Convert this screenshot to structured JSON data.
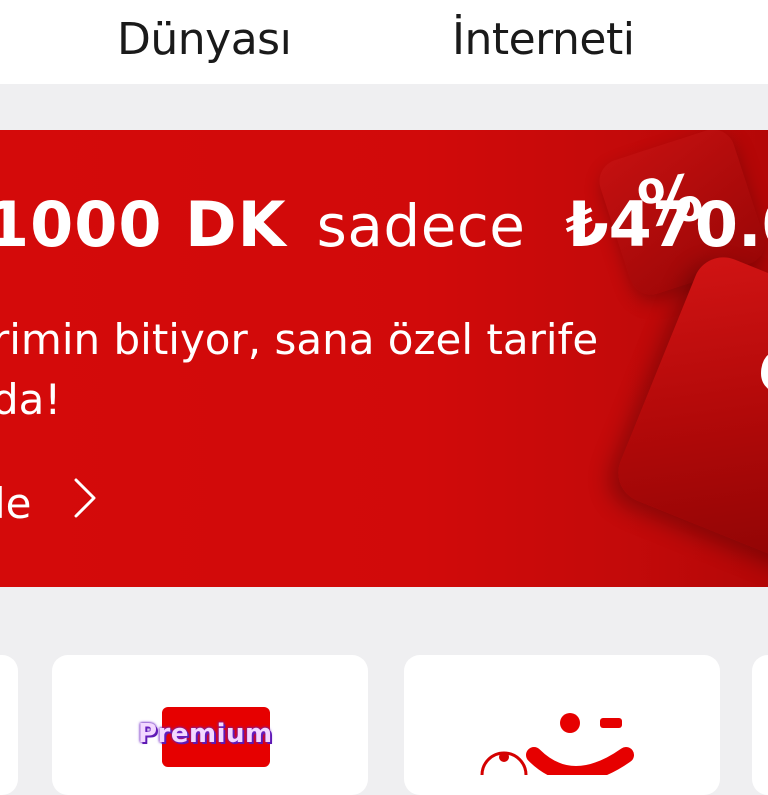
{
  "tabs": [
    {
      "label": "Dünyası"
    },
    {
      "label": "İnterneti"
    }
  ],
  "banner": {
    "minutes": "1000 DK",
    "connector": "sadece",
    "price": "₺470.0",
    "description_line1": "rimin bitiyor, sana özel tarife",
    "description_line2": "da!",
    "cta_label": "le",
    "accent_color": "#e60000"
  },
  "cards": [
    {
      "badge_text": "Premium"
    }
  ],
  "icons": [
    "chevron-right-icon",
    "discount-cube-icon",
    "premium-badge-icon",
    "smile-logo-icon"
  ]
}
